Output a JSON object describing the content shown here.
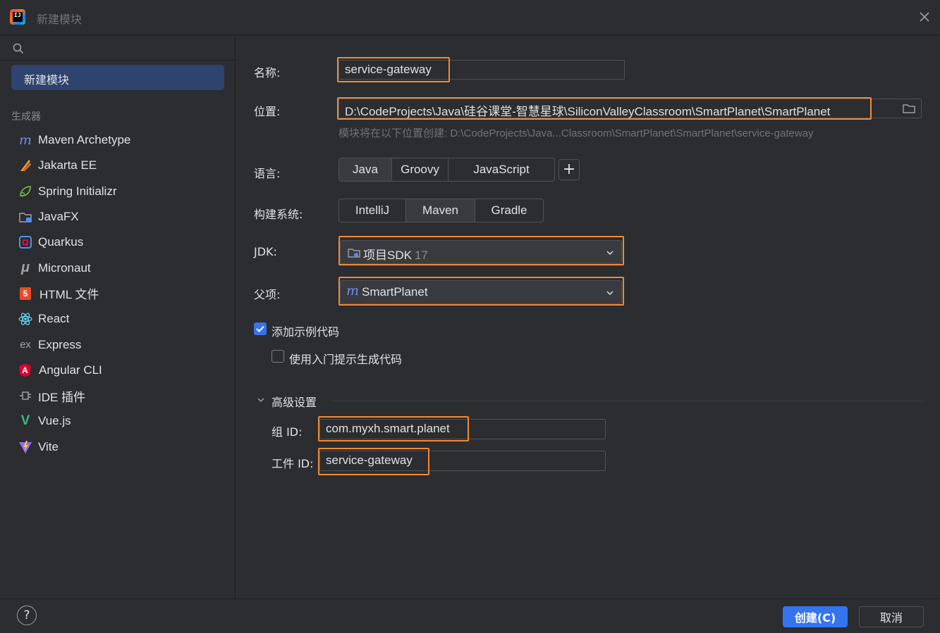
{
  "window": {
    "title": "新建模块",
    "icon": "intellij-logo-icon",
    "logo_text": "IJ"
  },
  "sidebar": {
    "selected_label": "新建模块",
    "section_label": "生成器",
    "generators": [
      {
        "label": "Maven Archetype",
        "icon": "maven-icon"
      },
      {
        "label": "Jakarta EE",
        "icon": "jakarta-ee-icon"
      },
      {
        "label": "Spring Initializr",
        "icon": "spring-icon"
      },
      {
        "label": "JavaFX",
        "icon": "javafx-folder-icon"
      },
      {
        "label": "Quarkus",
        "icon": "quarkus-icon"
      },
      {
        "label": "Micronaut",
        "icon": "micronaut-icon"
      },
      {
        "label": "HTML 文件",
        "icon": "html5-icon"
      },
      {
        "label": "React",
        "icon": "react-icon"
      },
      {
        "label": "Express",
        "icon": "express-icon"
      },
      {
        "label": "Angular CLI",
        "icon": "angular-icon"
      },
      {
        "label": "IDE 插件",
        "icon": "plugin-icon"
      },
      {
        "label": "Vue.js",
        "icon": "vue-icon"
      },
      {
        "label": "Vite",
        "icon": "vite-icon"
      }
    ],
    "icon_text": {
      "maven": "m",
      "html5": "5",
      "express": "ex",
      "angular": "A",
      "vue": "V",
      "micronaut": "μ"
    }
  },
  "form": {
    "name_label": "名称:",
    "name_value": "service-gateway",
    "location_label": "位置:",
    "location_value": "D:\\CodeProjects\\Java\\硅谷课堂-智慧星球\\SiliconValleyClassroom\\SmartPlanet\\SmartPlanet",
    "location_hint": "模块将在以下位置创建: D:\\CodeProjects\\Java...Classroom\\SmartPlanet\\SmartPlanet\\service-gateway",
    "language_label": "语言:",
    "languages": [
      "Java",
      "Groovy",
      "JavaScript"
    ],
    "language_selected": "Java",
    "add_language": "+",
    "build_label": "构建系统:",
    "build_systems": [
      "IntelliJ",
      "Maven",
      "Gradle"
    ],
    "build_selected": "Maven",
    "jdk_label": "JDK:",
    "jdk_value": "项目SDK",
    "jdk_version": "17",
    "parent_label": "父项:",
    "parent_icon_text": "m",
    "parent_value": "SmartPlanet",
    "add_sample_label": "添加示例代码",
    "add_sample_checked": true,
    "onboarding_label": "使用入门提示生成代码",
    "onboarding_checked": false,
    "advanced_label": "高级设置",
    "group_id_label": "组 ID:",
    "group_id_value": "com.myxh.smart.planet",
    "artifact_id_label": "工件 ID:",
    "artifact_id_value": "service-gateway"
  },
  "footer": {
    "help_label": "?",
    "create_label": "创建(C)",
    "cancel_label": "取消"
  },
  "colors": {
    "highlight": "#f28a35",
    "accent": "#3574f0",
    "background": "#2b2d30"
  }
}
